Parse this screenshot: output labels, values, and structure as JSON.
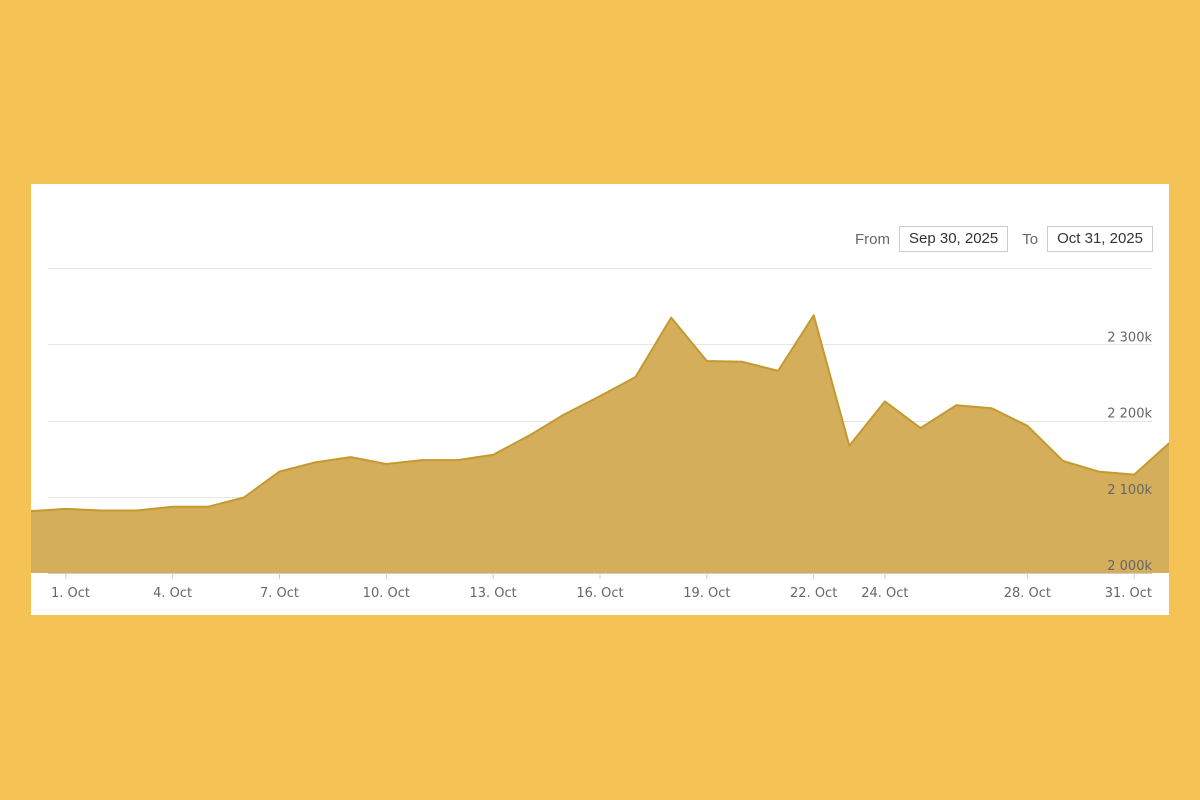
{
  "range": {
    "from_label": "From",
    "from_value": "Sep 30, 2025",
    "to_label": "To",
    "to_value": "Oct 31, 2025"
  },
  "colors": {
    "background": "#F4C255",
    "area_fill": "#D4AE5B",
    "area_stroke": "#C49A2E",
    "grid": "#e6e6e6"
  },
  "chart_data": {
    "type": "area",
    "x_start": "2025-09-30",
    "x_end": "2025-10-31",
    "ylim": [
      2000,
      2400
    ],
    "y_unit": "k",
    "y_ticks": [
      {
        "value": 2000,
        "label": "2 000k"
      },
      {
        "value": 2100,
        "label": "2 100k"
      },
      {
        "value": 2200,
        "label": "2 200k"
      },
      {
        "value": 2300,
        "label": "2 300k"
      }
    ],
    "x_ticks": [
      {
        "date": "2025-10-01",
        "label": "1. Oct"
      },
      {
        "date": "2025-10-04",
        "label": "4. Oct"
      },
      {
        "date": "2025-10-07",
        "label": "7. Oct"
      },
      {
        "date": "2025-10-10",
        "label": "10. Oct"
      },
      {
        "date": "2025-10-13",
        "label": "13. Oct"
      },
      {
        "date": "2025-10-16",
        "label": "16. Oct"
      },
      {
        "date": "2025-10-19",
        "label": "19. Oct"
      },
      {
        "date": "2025-10-22",
        "label": "22. Oct"
      },
      {
        "date": "2025-10-24",
        "label": "24. Oct"
      },
      {
        "date": "2025-10-28",
        "label": "28. Oct"
      },
      {
        "date": "2025-10-31",
        "label": "31. Oct"
      }
    ],
    "grid": true,
    "legend": "none",
    "series": [
      {
        "points": [
          {
            "x": "2025-09-30",
            "y": 2081
          },
          {
            "x": "2025-10-01",
            "y": 2084
          },
          {
            "x": "2025-10-02",
            "y": 2082
          },
          {
            "x": "2025-10-03",
            "y": 2082
          },
          {
            "x": "2025-10-04",
            "y": 2087
          },
          {
            "x": "2025-10-05",
            "y": 2087
          },
          {
            "x": "2025-10-06",
            "y": 2099
          },
          {
            "x": "2025-10-07",
            "y": 2133
          },
          {
            "x": "2025-10-08",
            "y": 2145
          },
          {
            "x": "2025-10-09",
            "y": 2152
          },
          {
            "x": "2025-10-10",
            "y": 2143
          },
          {
            "x": "2025-10-11",
            "y": 2148
          },
          {
            "x": "2025-10-12",
            "y": 2148
          },
          {
            "x": "2025-10-13",
            "y": 2155
          },
          {
            "x": "2025-10-14",
            "y": 2180
          },
          {
            "x": "2025-10-15",
            "y": 2208
          },
          {
            "x": "2025-10-16",
            "y": 2232
          },
          {
            "x": "2025-10-17",
            "y": 2257
          },
          {
            "x": "2025-10-18",
            "y": 2335
          },
          {
            "x": "2025-10-19",
            "y": 2278
          },
          {
            "x": "2025-10-20",
            "y": 2277
          },
          {
            "x": "2025-10-21",
            "y": 2265
          },
          {
            "x": "2025-10-22",
            "y": 2338
          },
          {
            "x": "2025-10-23",
            "y": 2167
          },
          {
            "x": "2025-10-24",
            "y": 2225
          },
          {
            "x": "2025-10-25",
            "y": 2190
          },
          {
            "x": "2025-10-26",
            "y": 2220
          },
          {
            "x": "2025-10-27",
            "y": 2216
          },
          {
            "x": "2025-10-28",
            "y": 2193
          },
          {
            "x": "2025-10-29",
            "y": 2147
          },
          {
            "x": "2025-10-30",
            "y": 2133
          },
          {
            "x": "2025-10-31",
            "y": 2129
          },
          {
            "x": "2025-11-01",
            "y": 2171
          }
        ]
      }
    ]
  }
}
